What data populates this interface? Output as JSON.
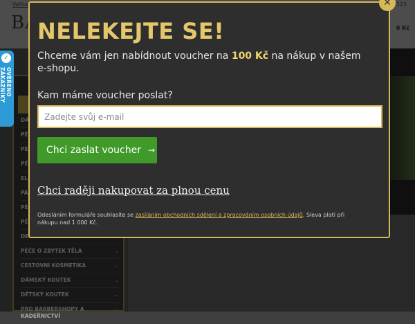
{
  "page": {
    "top_link": "Veľkoo",
    "phone_partial": "123",
    "logo_text": "BA",
    "cart_price": "0 Kč"
  },
  "sidebar": {
    "items": [
      {
        "label": "DÁ"
      },
      {
        "label": "PÉ"
      },
      {
        "label": "PÉ"
      },
      {
        "label": "PÉ"
      },
      {
        "label": "EL"
      },
      {
        "label": "PÁ KO"
      },
      {
        "label": "PÉ"
      },
      {
        "label": "PÉ"
      },
      {
        "label": "DE"
      },
      {
        "label": "PÉČE O ZBYTEK TĚLA"
      },
      {
        "label": "CESTOVNÍ KOSMETIKA"
      },
      {
        "label": "DÁMSKÝ KOUTEK"
      },
      {
        "label": "DĚTSKÝ KOUTEK"
      },
      {
        "label": "PRO BARBERSHOPY A KADEŘNICTVÍ"
      }
    ]
  },
  "badge": {
    "text": "OVĚŘENO ZÁKAZNÍKY",
    "icon": "shield-check-icon"
  },
  "modal": {
    "title": "NELEKEJTE SE!",
    "intro_before": "Chceme vám jen nabídnout voucher na ",
    "amount": "100 Kč",
    "intro_after": " na nákup v našem e-shopu.",
    "email_label": "Kam máme voucher poslat?",
    "email_placeholder": "Zadejte svůj e-mail",
    "email_value": "",
    "submit_label": "Chci zaslat voucher",
    "submit_arrow": "→",
    "fullprice_link": "Chci raději nakupovat za plnou cenu",
    "disclaimer_before": "Odesláním formuláře souhlasíte se ",
    "disclaimer_link": "zasíláním obchodních sdělení a zpracováním osobních údajů",
    "disclaimer_after": ". Sleva platí při nákupu nad 1 000 Kč.",
    "close_icon": "close-icon"
  },
  "colors": {
    "accent_gold": "#d7b95a",
    "title_gold": "#e3c76a",
    "button_green": "#3f9a2a",
    "badge_blue": "#2e9bd6",
    "modal_bg": "#2e2e2e"
  }
}
